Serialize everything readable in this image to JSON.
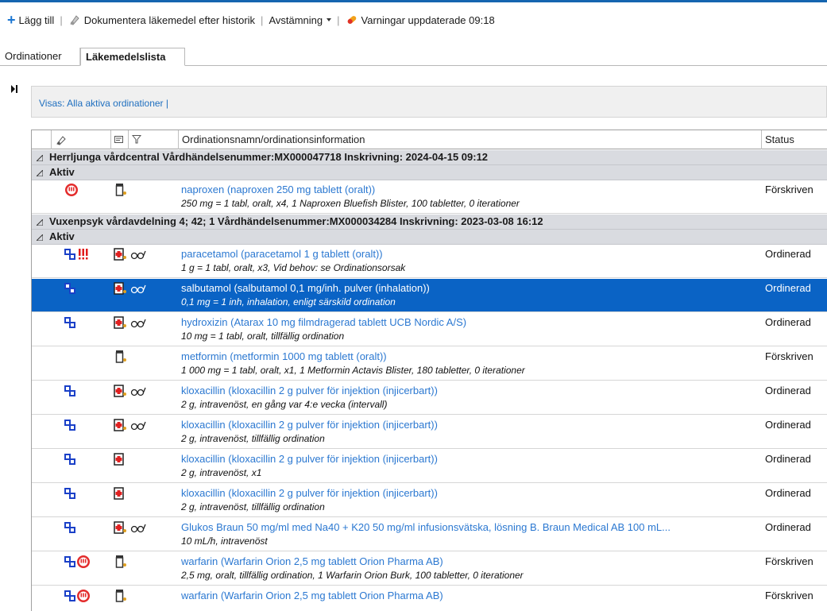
{
  "toolbar": {
    "add_label": "Lägg till",
    "document_label": "Dokumentera läkemedel efter historik",
    "reconcile_label": "Avstämning",
    "warnings_label": "Varningar uppdaterade 09:18"
  },
  "tabs": {
    "orders_label": "Ordinationer",
    "druglist_label": "Läkemedelslista"
  },
  "filter": {
    "text": "Visas: Alla aktiva ordinationer  |"
  },
  "grid": {
    "columns": {
      "warning_icon": "warning-icon",
      "note_icon": "note-icon",
      "filter_icon": "funnel-icon",
      "name": "Ordinationsnamn/ordinationsinformation",
      "status": "Status"
    },
    "group1": {
      "header": "Herrljunga vårdcentral  Vårdhändelsenummer:MX000047718  Inskrivning: 2024-04-15 09:12",
      "sub": "Aktiv",
      "rows": [
        {
          "name": "naproxen (naproxen 250 mg tablett (oralt))",
          "info": "250 mg = 1 tabl, oralt, x4, 1 Naproxen Bluefish Blister, 100 tabletter, 0 iterationer",
          "status": "Förskriven"
        }
      ]
    },
    "group2": {
      "header": "Vuxenpsyk vårdavdelning 4; 42; 1  Vårdhändelsenummer:MX000034284  Inskrivning: 2023-03-08 16:12",
      "sub": "Aktiv",
      "rows": [
        {
          "name": "paracetamol (paracetamol 1 g tablett (oralt))",
          "info": "1 g = 1 tabl, oralt, x3, Vid behov: se Ordinationsorsak",
          "status": "Ordinerad"
        },
        {
          "name": "salbutamol (salbutamol 0,1 mg/inh. pulver (inhalation))",
          "info": "0,1 mg = 1 inh, inhalation, enligt särskild ordination",
          "status": "Ordinerad"
        },
        {
          "name": "hydroxizin (Atarax 10 mg filmdragerad tablett UCB Nordic A/S)",
          "info": "10 mg = 1 tabl, oralt, tillfällig ordination",
          "status": "Ordinerad"
        },
        {
          "name": "metformin (metformin 1000 mg tablett (oralt))",
          "info": "1 000 mg = 1 tabl, oralt, x1, 1 Metformin Actavis Blister, 180 tabletter, 0 iterationer",
          "status": "Förskriven"
        },
        {
          "name": "kloxacillin (kloxacillin 2 g pulver för injektion (injicerbart))",
          "info": "2 g, intravenöst, en gång var 4:e vecka (intervall)",
          "status": "Ordinerad"
        },
        {
          "name": "kloxacillin (kloxacillin 2 g pulver för injektion (injicerbart))",
          "info": "2 g, intravenöst, tillfällig ordination",
          "status": "Ordinerad"
        },
        {
          "name": "kloxacillin (kloxacillin 2 g pulver för injektion (injicerbart))",
          "info": "2 g, intravenöst, x1",
          "status": "Ordinerad"
        },
        {
          "name": "kloxacillin (kloxacillin 2 g pulver för injektion (injicerbart))",
          "info": "2 g, intravenöst, tillfällig ordination",
          "status": "Ordinerad"
        },
        {
          "name": "Glukos Braun 50 mg/ml med Na40 + K20 50 mg/ml infusionsvätska, lösning B. Braun Medical AB 100 mL...",
          "info": "10 mL/h, intravenöst",
          "status": "Ordinerad"
        },
        {
          "name": "warfarin (Warfarin Orion 2,5 mg tablett Orion Pharma AB)",
          "info": "2,5 mg, oralt, tillfällig ordination, 1 Warfarin Orion Burk, 100 tabletter, 0 iterationer",
          "status": "Förskriven"
        },
        {
          "name": "warfarin (Warfarin Orion 2,5 mg tablett Orion Pharma AB)",
          "info": "",
          "status": "Förskriven"
        }
      ]
    }
  },
  "colors": {
    "accent": "#1565b0",
    "selection": "#0a63c5",
    "link": "#2b78d1",
    "group_bg": "#d9dbe0"
  }
}
